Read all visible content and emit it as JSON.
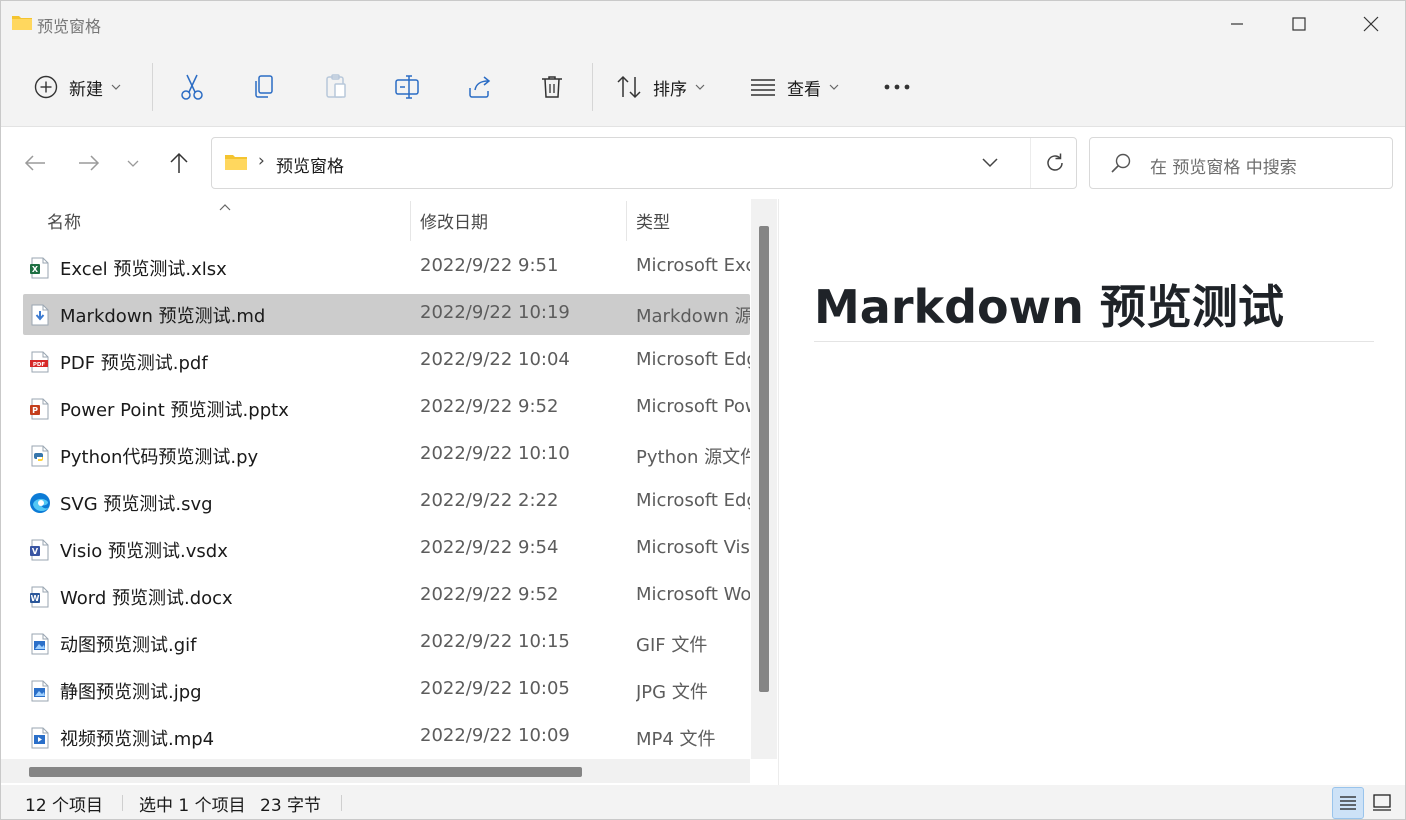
{
  "window": {
    "title": "预览窗格"
  },
  "toolbar": {
    "new_label": "新建",
    "sort_label": "排序",
    "view_label": "查看"
  },
  "address": {
    "path": "预览窗格",
    "search_placeholder": "在 预览窗格 中搜索"
  },
  "columns": {
    "name": "名称",
    "date": "修改日期",
    "type": "类型"
  },
  "files": [
    {
      "name": "Excel 预览测试.xlsx",
      "date": "2022/9/22 9:51",
      "type": "Microsoft Excel",
      "icon": "excel-icon",
      "color": "#1d6f42"
    },
    {
      "name": "Markdown 预览测试.md",
      "date": "2022/9/22 10:19",
      "type": "Markdown 源文件",
      "icon": "markdown-file-icon",
      "color": "#3c7bd1"
    },
    {
      "name": "PDF 预览测试.pdf",
      "date": "2022/9/22 10:04",
      "type": "Microsoft Edge",
      "icon": "pdf-icon",
      "color": "#d62828"
    },
    {
      "name": "Power Point 预览测试.pptx",
      "date": "2022/9/22 9:52",
      "type": "Microsoft PowerPoint",
      "icon": "powerpoint-icon",
      "color": "#c43e1c"
    },
    {
      "name": "Python代码预览测试.py",
      "date": "2022/9/22 10:10",
      "type": "Python 源文件",
      "icon": "python-icon",
      "color": "#3776ab"
    },
    {
      "name": "SVG 预览测试.svg",
      "date": "2022/9/22 2:22",
      "type": "Microsoft Edge",
      "icon": "edge-icon",
      "color": "#0c7bd6"
    },
    {
      "name": "Visio 预览测试.vsdx",
      "date": "2022/9/22 9:54",
      "type": "Microsoft Visio",
      "icon": "visio-icon",
      "color": "#3955a3"
    },
    {
      "name": "Word 预览测试.docx",
      "date": "2022/9/22 9:52",
      "type": "Microsoft Word",
      "icon": "word-icon",
      "color": "#2b579a"
    },
    {
      "name": "动图预览测试.gif",
      "date": "2022/9/22 10:15",
      "type": "GIF 文件",
      "icon": "image-file-icon",
      "color": "#2a6fc9"
    },
    {
      "name": "静图预览测试.jpg",
      "date": "2022/9/22 10:05",
      "type": "JPG 文件",
      "icon": "image-file-icon",
      "color": "#2a6fc9"
    },
    {
      "name": "视频预览测试.mp4",
      "date": "2022/9/22 10:09",
      "type": "MP4 文件",
      "icon": "video-file-icon",
      "color": "#2a6fc9"
    }
  ],
  "selected_index": 1,
  "preview": {
    "heading": "Markdown 预览测试"
  },
  "status": {
    "item_count": "12 个项目",
    "selection": "选中 1 个项目",
    "size": "23 字节"
  },
  "colors": {
    "accent": "#0067c0",
    "folder": "#f4c430",
    "selected_row": "#cccccc"
  }
}
